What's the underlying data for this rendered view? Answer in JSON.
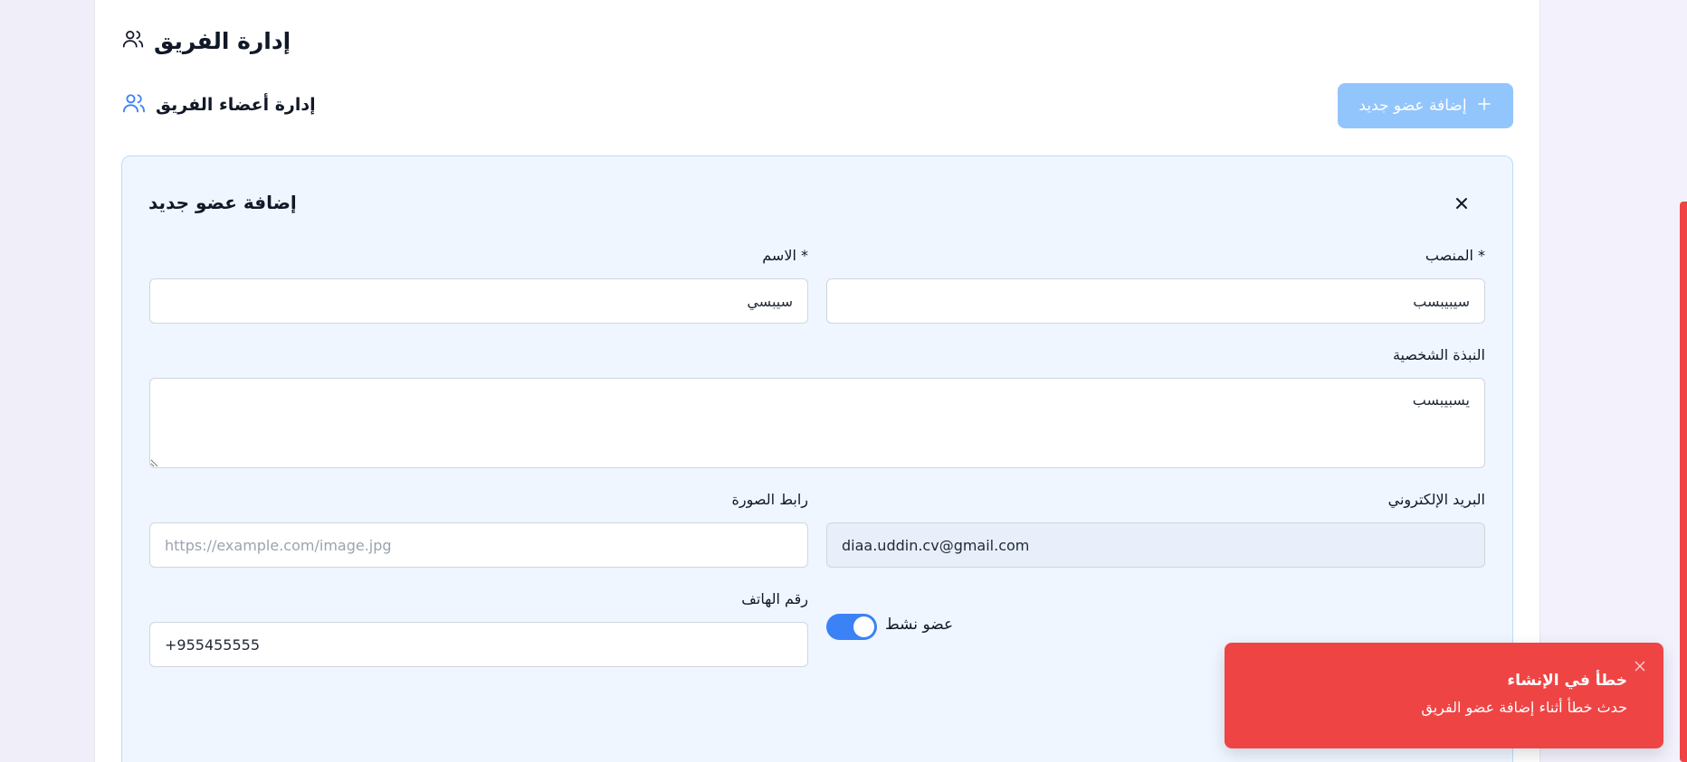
{
  "page": {
    "title": "إدارة الفريق",
    "section_title": "إدارة أعضاء الفريق",
    "add_button_label": "إضافة عضو جديد"
  },
  "form": {
    "title": "إضافة عضو جديد",
    "fields": {
      "position": {
        "label": "* المنصب",
        "value": "سيبيبسب"
      },
      "name": {
        "label": "* الاسم",
        "value": "سيبسي"
      },
      "bio": {
        "label": "النبذة الشخصية",
        "value": "يسبيبسب"
      },
      "email": {
        "label": "البريد الإلكتروني",
        "value": "diaa.uddin.cv@gmail.com"
      },
      "image_url": {
        "label": "رابط الصورة",
        "placeholder": "https://example.com/image.jpg",
        "value": ""
      },
      "phone": {
        "label": "رقم الهاتف",
        "value": "+955455555"
      }
    },
    "active_toggle": {
      "label": "عضو نشط",
      "on": true
    }
  },
  "toast": {
    "title": "خطأ في الإنشاء",
    "message": "حدث خطأ أثناء إضافة عضو الفريق"
  },
  "colors": {
    "accent": "#3b82f6",
    "add_button_bg": "#93c5fd",
    "panel_bg": "#eff6ff",
    "toast_bg": "#ef4444"
  },
  "icons": {
    "page_title": "users-icon",
    "section_title": "users-icon",
    "add_button": "plus-icon",
    "form_close": "close-icon",
    "toast_close": "close-icon"
  }
}
